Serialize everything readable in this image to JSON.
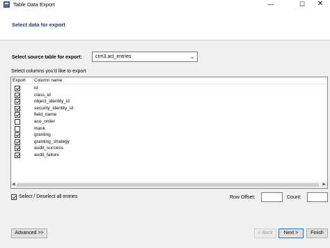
{
  "window": {
    "title": "Table Data Export",
    "minimize": "—",
    "maximize": "☐",
    "close": "✕"
  },
  "header": {
    "title": "Select data for export"
  },
  "source": {
    "label": "Select source table for export:",
    "value": "crm3.acl_entries"
  },
  "columns_label": "Select columns you'd like to export",
  "table": {
    "headers": [
      "Export",
      "Column name"
    ],
    "rows": [
      {
        "name": "id",
        "checked": true
      },
      {
        "name": "class_id",
        "checked": true
      },
      {
        "name": "object_identity_id",
        "checked": true
      },
      {
        "name": "security_identity_id",
        "checked": true
      },
      {
        "name": "field_name",
        "checked": true
      },
      {
        "name": "ace_order",
        "checked": false
      },
      {
        "name": "mask",
        "checked": false
      },
      {
        "name": "granting",
        "checked": true
      },
      {
        "name": "granting_strategy",
        "checked": true
      },
      {
        "name": "audit_success",
        "checked": true
      },
      {
        "name": "audit_failure",
        "checked": true
      }
    ]
  },
  "select_all": {
    "label": "Select / Deselect all entries",
    "checked": true
  },
  "row_offset": {
    "label": "Row Offset:",
    "value": ""
  },
  "count": {
    "label": "Count:",
    "value": ""
  },
  "buttons": {
    "advanced": "Advanced >>",
    "back": "< Back",
    "next": "Next >",
    "finish": "Finish"
  }
}
